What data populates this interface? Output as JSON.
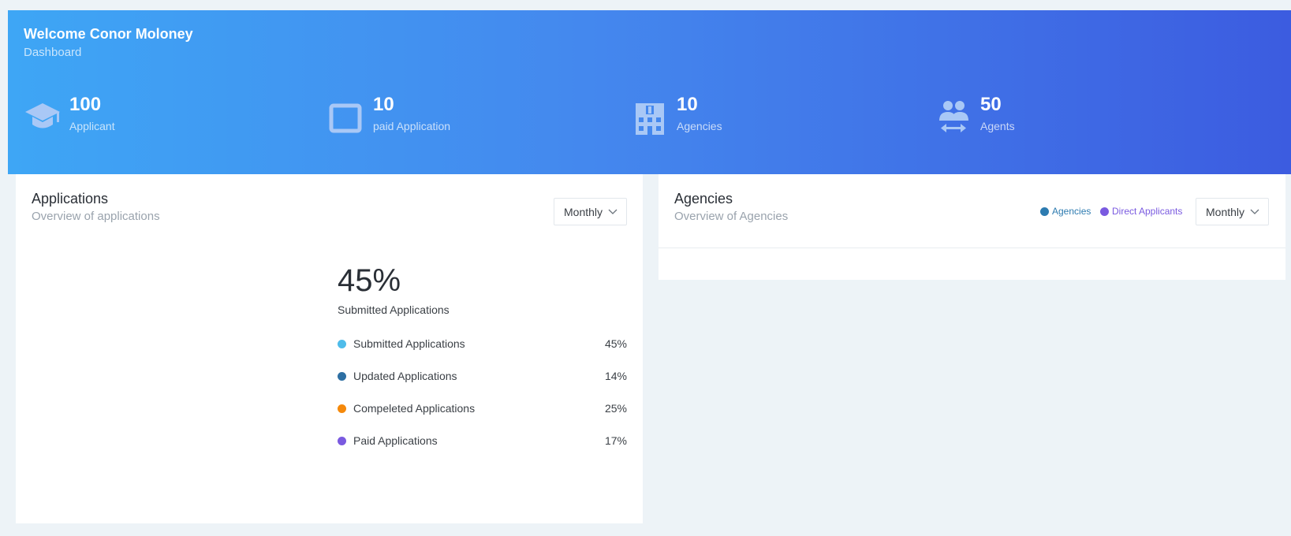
{
  "header": {
    "welcome": "Welcome Conor Moloney",
    "subtitle": "Dashboard"
  },
  "stats": [
    {
      "value": "100",
      "label": "Applicant",
      "icon": "graduation-cap-icon"
    },
    {
      "value": "10",
      "label": "paid Application",
      "icon": "window-icon"
    },
    {
      "value": "10",
      "label": "Agencies",
      "icon": "building-icon"
    },
    {
      "value": "50",
      "label": "Agents",
      "icon": "agents-exchange-icon"
    }
  ],
  "applications": {
    "title": "Applications",
    "subtitle": "Overview of applications",
    "period": "Monthly",
    "headline_value": "45%",
    "headline_caption": "Submitted Applications",
    "breakdown": [
      {
        "name": "Submitted Applications",
        "value": "45%",
        "color": "#4fbcea"
      },
      {
        "name": "Updated Applications",
        "value": "14%",
        "color": "#2d6fa3"
      },
      {
        "name": "Compeleted Applications",
        "value": "25%",
        "color": "#f5890b"
      },
      {
        "name": "Paid Applications",
        "value": "17%",
        "color": "#7a5ae0"
      }
    ]
  },
  "agencies": {
    "title": "Agencies",
    "subtitle": "Overview of Agencies",
    "period": "Monthly",
    "legend": [
      {
        "name": "Agencies",
        "color": "#2d7bb0"
      },
      {
        "name": "Direct Applicants",
        "color": "#7a5ae0"
      }
    ]
  },
  "colors": {
    "banner_start": "#3ea6f5",
    "banner_end": "#3c5ce0",
    "icon_tint": "#a9c8f6"
  }
}
